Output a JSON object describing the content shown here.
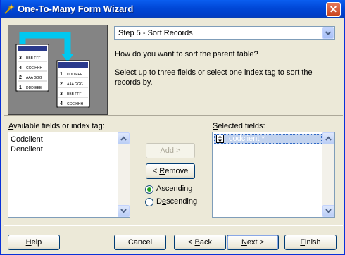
{
  "window": {
    "title": "One-To-Many Form Wizard"
  },
  "step": {
    "selected": "Step 5 - Sort Records"
  },
  "instructions": {
    "line1": "How do you want to sort the parent table?",
    "line2a": "Select up to three fields or select one index tag to sort the",
    "line2b": "records by."
  },
  "available": {
    "label_pre": "",
    "label_u": "A",
    "label_post": "vailable fields or index tag:",
    "items": [
      "Codclient",
      "Denclient"
    ]
  },
  "selected_fields": {
    "label_pre": "",
    "label_u": "S",
    "label_post": "elected fields:",
    "items": [
      "codclient *"
    ]
  },
  "buttons": {
    "add": "Add >",
    "remove_pre": "< ",
    "remove_u": "R",
    "remove_post": "emove",
    "help_u": "H",
    "help_post": "elp",
    "cancel": "Cancel",
    "back_pre": "< ",
    "back_u": "B",
    "back_post": "ack",
    "next_u": "N",
    "next_post": "ext >",
    "finish_u": "F",
    "finish_post": "inish"
  },
  "sort": {
    "asc_pre": "As",
    "asc_u": "c",
    "asc_post": "ending",
    "desc_pre": "D",
    "desc_u": "e",
    "desc_post": "scending",
    "selected": "ascending"
  },
  "picture": {
    "left_rows": [
      [
        "3",
        "BBB FFF"
      ],
      [
        "4",
        "CCC HHH"
      ],
      [
        "2",
        "AAA GGG"
      ],
      [
        "1",
        "DDD EEE"
      ]
    ],
    "right_rows": [
      [
        "1",
        "DDD EEE"
      ],
      [
        "2",
        "AAA GGG"
      ],
      [
        "3",
        "BBB FFF"
      ],
      [
        "4",
        "CCC HHH"
      ]
    ]
  },
  "colors": {
    "titlebar": "#0054e3",
    "highlight": "#c1d2ee",
    "arrow": "#00c8f0"
  }
}
